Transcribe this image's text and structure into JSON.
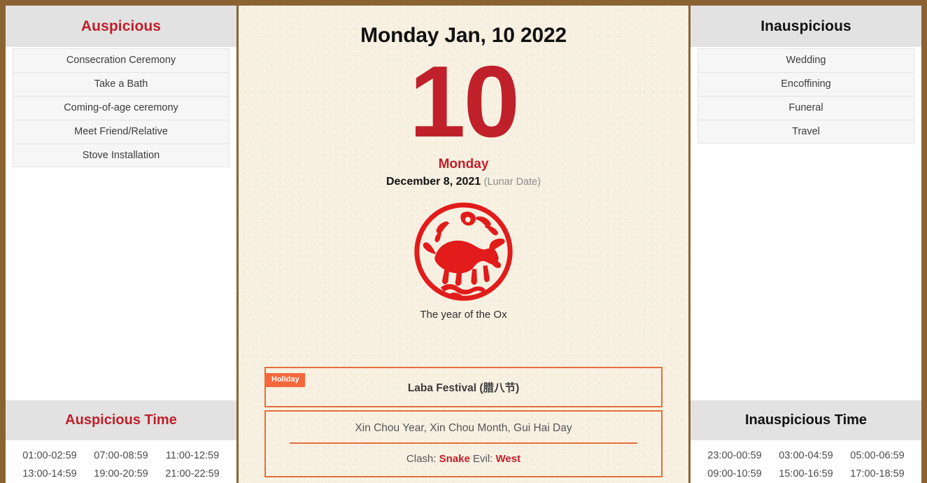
{
  "theme": {
    "frame_color": "#8B6332",
    "paper_color": "#f7f0e1",
    "accent_red": "#bf1f2a",
    "accent_orange": "#e2703a",
    "badge_orange": "#f2683c",
    "panel_head_gray": "#e2e2e2"
  },
  "left_panel": {
    "header": "Auspicious",
    "items": [
      "Consecration Ceremony",
      "Take a Bath",
      "Coming-of-age ceremony",
      "Meet Friend/Relative",
      "Stove Installation"
    ],
    "time_header": "Auspicious Time",
    "times": [
      "01:00-02:59",
      "07:00-08:59",
      "11:00-12:59",
      "13:00-14:59",
      "19:00-20:59",
      "21:00-22:59"
    ]
  },
  "right_panel": {
    "header": "Inauspicious",
    "items": [
      "Wedding",
      "Encoffining",
      "Funeral",
      "Travel"
    ],
    "time_header": "Inauspicious Time",
    "times": [
      "23:00-00:59",
      "03:00-04:59",
      "05:00-06:59",
      "09:00-10:59",
      "15:00-16:59",
      "17:00-18:59"
    ]
  },
  "center": {
    "title": "Monday Jan, 10 2022",
    "day_number": "10",
    "weekday": "Monday",
    "lunar_date": "December 8, 2021",
    "lunar_label": "(Lunar Date)",
    "zodiac_icon": "ox-papercut-icon",
    "zodiac_caption": "The year of the Ox",
    "holiday_badge": "Holiday",
    "festival_name": "Laba Festival (腊八节)",
    "ganzhi": "Xin Chou Year, Xin Chou Month, Gui Hai Day",
    "clash_prefix": "Clash:",
    "clash_value": "Snake",
    "evil_prefix": "Evil:",
    "evil_value": "West"
  }
}
